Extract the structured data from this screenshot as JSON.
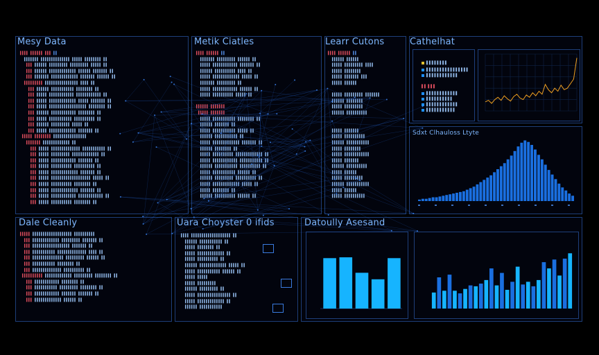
{
  "panels": {
    "messy_data": {
      "title": "Mesy Data"
    },
    "metrics": {
      "title": "Metik Ciatles"
    },
    "learn": {
      "title": "Learr Cutons"
    },
    "cathetat": {
      "title": "Cathelhat"
    },
    "data_cleaning": {
      "title": "Dale Cleanly"
    },
    "cluster": {
      "title": "Uara Choyster 0 ifids"
    },
    "quality": {
      "title": "Datoully Asesand"
    },
    "hist_label": {
      "title": "Sdxt Clhauloss Ltyte"
    }
  },
  "colors": {
    "accent": "#1e90ff",
    "bar_bright": "#16b4ff",
    "bar_mid": "#1a6fe0",
    "line_orange": "#f0a020",
    "code_red": "#d94b5c",
    "panel_border": "#1e3f7a"
  },
  "icons": [
    "window-icon",
    "chart-icon"
  ],
  "chart_data": [
    {
      "type": "line",
      "x": [
        0,
        1,
        2,
        3,
        4,
        5,
        6,
        7,
        8,
        9,
        10,
        11,
        12,
        13,
        14,
        15,
        16,
        17,
        18,
        19,
        20,
        21,
        22,
        23,
        24,
        25,
        26,
        27,
        28,
        29
      ],
      "series": [
        {
          "values": [
            12,
            14,
            10,
            15,
            18,
            14,
            20,
            16,
            13,
            19,
            22,
            17,
            15,
            21,
            18,
            24,
            20,
            26,
            22,
            35,
            28,
            24,
            30,
            26,
            34,
            28,
            30,
            36,
            42,
            70
          ]
        }
      ]
    },
    {
      "type": "bar",
      "values": [
        2,
        3,
        3,
        4,
        5,
        5,
        6,
        7,
        8,
        9,
        10,
        11,
        12,
        13,
        15,
        17,
        19,
        22,
        25,
        28,
        31,
        34,
        38,
        42,
        46,
        50,
        55,
        60,
        66,
        72,
        77,
        80,
        78,
        74,
        68,
        61,
        55,
        48,
        41,
        35,
        29,
        23,
        18,
        14,
        10,
        7
      ]
    },
    {
      "type": "bar",
      "values": [
        62,
        63,
        44,
        36,
        62
      ]
    },
    {
      "type": "bar",
      "values": [
        18,
        35,
        20,
        38,
        20,
        17,
        22,
        26,
        25,
        28,
        32,
        45,
        26,
        40,
        21,
        30,
        47,
        27,
        30,
        25,
        32,
        52,
        45,
        55,
        37,
        56,
        62
      ]
    }
  ]
}
